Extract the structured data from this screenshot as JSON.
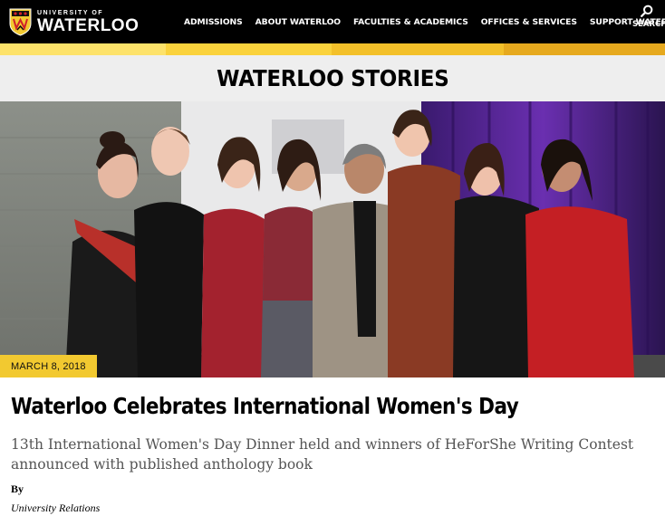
{
  "header": {
    "logo": {
      "line1": "UNIVERSITY OF",
      "line2": "WATERLOO",
      "icon": "university-crest-icon"
    },
    "nav": [
      {
        "label": "ADMISSIONS"
      },
      {
        "label": "ABOUT WATERLOO"
      },
      {
        "label": "FACULTIES & ACADEMICS"
      },
      {
        "label": "OFFICES & SERVICES"
      },
      {
        "label": "SUPPORT WATERLOO"
      }
    ],
    "search": {
      "label": "SEARCH",
      "icon": "search-icon"
    }
  },
  "colors": {
    "header_bg": "#000000",
    "stripe": [
      "#fde26a",
      "#fad23c",
      "#f3c02a",
      "#e6a91e"
    ],
    "banner_bg": "#eeeeee",
    "badge": "#f2c930"
  },
  "section": {
    "title": "WATERLOO STORIES"
  },
  "article": {
    "date": "MARCH 8, 2018",
    "title": "Waterloo Celebrates International Women's Day",
    "summary": "13th International Women's Day Dinner held and winners of HeForShe Writing Contest announced with published anthology book",
    "byline_label": "By",
    "author": "University Relations",
    "image": "group photo of eight women standing together in front of a purple curtain"
  }
}
